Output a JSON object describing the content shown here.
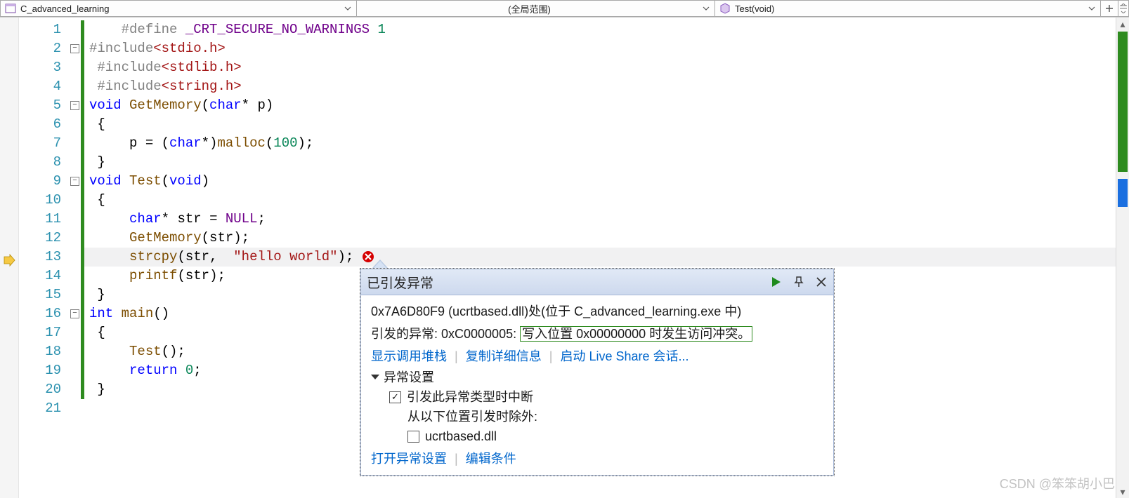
{
  "nav": {
    "left_label": "C_advanced_learning",
    "mid_label": "(全局范围)",
    "right_label": "Test(void)"
  },
  "lines": [
    {
      "n": 1,
      "fold": null,
      "chg": true,
      "tokens": [
        [
          "sp",
          "    "
        ],
        [
          "inc",
          "#define "
        ],
        [
          "mac",
          "_CRT_SECURE_NO_WARNINGS"
        ],
        [
          "sp",
          " "
        ],
        [
          "num",
          "1"
        ]
      ]
    },
    {
      "n": 2,
      "fold": "minus",
      "chg": true,
      "tokens": [
        [
          "inc",
          "#include"
        ],
        [
          "ang",
          "<stdio.h>"
        ]
      ]
    },
    {
      "n": 3,
      "fold": null,
      "chg": true,
      "tokens": [
        [
          "sp",
          " "
        ],
        [
          "inc",
          "#include"
        ],
        [
          "ang",
          "<stdlib.h>"
        ]
      ]
    },
    {
      "n": 4,
      "fold": null,
      "chg": true,
      "tokens": [
        [
          "sp",
          " "
        ],
        [
          "inc",
          "#include"
        ],
        [
          "ang",
          "<string.h>"
        ]
      ]
    },
    {
      "n": 5,
      "fold": "minus",
      "chg": true,
      "tokens": [
        [
          "kw",
          "void"
        ],
        [
          "sp",
          " "
        ],
        [
          "fn",
          "GetMemory"
        ],
        [
          "op",
          "("
        ],
        [
          "kw",
          "char"
        ],
        [
          "op",
          "* "
        ],
        [
          "id",
          "p"
        ],
        [
          "op",
          ")"
        ]
      ]
    },
    {
      "n": 6,
      "fold": null,
      "chg": true,
      "tokens": [
        [
          "sp",
          " "
        ],
        [
          "op",
          "{"
        ]
      ]
    },
    {
      "n": 7,
      "fold": null,
      "chg": true,
      "tokens": [
        [
          "sp",
          "     "
        ],
        [
          "id",
          "p"
        ],
        [
          "sp",
          " "
        ],
        [
          "op",
          "="
        ],
        [
          "sp",
          " "
        ],
        [
          "op",
          "("
        ],
        [
          "kw",
          "char"
        ],
        [
          "op",
          "*)"
        ],
        [
          "fn",
          "malloc"
        ],
        [
          "op",
          "("
        ],
        [
          "num",
          "100"
        ],
        [
          "op",
          ");"
        ]
      ]
    },
    {
      "n": 8,
      "fold": null,
      "chg": true,
      "tokens": [
        [
          "sp",
          " "
        ],
        [
          "op",
          "}"
        ]
      ]
    },
    {
      "n": 9,
      "fold": "minus",
      "chg": true,
      "tokens": [
        [
          "kw",
          "void"
        ],
        [
          "sp",
          " "
        ],
        [
          "fn",
          "Test"
        ],
        [
          "op",
          "("
        ],
        [
          "kw",
          "void"
        ],
        [
          "op",
          ")"
        ]
      ]
    },
    {
      "n": 10,
      "fold": null,
      "chg": true,
      "tokens": [
        [
          "sp",
          " "
        ],
        [
          "op",
          "{"
        ]
      ]
    },
    {
      "n": 11,
      "fold": null,
      "chg": true,
      "tokens": [
        [
          "sp",
          "     "
        ],
        [
          "kw",
          "char"
        ],
        [
          "op",
          "* "
        ],
        [
          "id",
          "str"
        ],
        [
          "sp",
          " "
        ],
        [
          "op",
          "="
        ],
        [
          "sp",
          " "
        ],
        [
          "nul",
          "NULL"
        ],
        [
          "op",
          ";"
        ]
      ]
    },
    {
      "n": 12,
      "fold": null,
      "chg": true,
      "tokens": [
        [
          "sp",
          "     "
        ],
        [
          "fn",
          "GetMemory"
        ],
        [
          "op",
          "("
        ],
        [
          "id",
          "str"
        ],
        [
          "op",
          ");"
        ]
      ]
    },
    {
      "n": 13,
      "fold": null,
      "chg": true,
      "current": true,
      "err": true,
      "tokens": [
        [
          "sp",
          "     "
        ],
        [
          "fn",
          "strcpy"
        ],
        [
          "op",
          "("
        ],
        [
          "id",
          "str"
        ],
        [
          "op",
          ","
        ],
        [
          "sp",
          "  "
        ],
        [
          "str",
          "\"hello world\""
        ],
        [
          "op",
          ");"
        ]
      ]
    },
    {
      "n": 14,
      "fold": null,
      "chg": true,
      "tokens": [
        [
          "sp",
          "     "
        ],
        [
          "fn",
          "printf"
        ],
        [
          "op",
          "("
        ],
        [
          "id",
          "str"
        ],
        [
          "op",
          ");"
        ]
      ]
    },
    {
      "n": 15,
      "fold": null,
      "chg": true,
      "tokens": [
        [
          "sp",
          " "
        ],
        [
          "op",
          "}"
        ]
      ]
    },
    {
      "n": 16,
      "fold": "minus",
      "chg": true,
      "tokens": [
        [
          "kw",
          "int"
        ],
        [
          "sp",
          " "
        ],
        [
          "fn",
          "main"
        ],
        [
          "op",
          "()"
        ]
      ]
    },
    {
      "n": 17,
      "fold": null,
      "chg": true,
      "tokens": [
        [
          "sp",
          " "
        ],
        [
          "op",
          "{"
        ]
      ]
    },
    {
      "n": 18,
      "fold": null,
      "chg": true,
      "tokens": [
        [
          "sp",
          "     "
        ],
        [
          "fn",
          "Test"
        ],
        [
          "op",
          "();"
        ]
      ]
    },
    {
      "n": 19,
      "fold": null,
      "chg": true,
      "tokens": [
        [
          "sp",
          "     "
        ],
        [
          "kw",
          "return"
        ],
        [
          "sp",
          " "
        ],
        [
          "num",
          "0"
        ],
        [
          "op",
          ";"
        ]
      ]
    },
    {
      "n": 20,
      "fold": null,
      "chg": true,
      "tokens": [
        [
          "sp",
          " "
        ],
        [
          "op",
          "}"
        ]
      ]
    },
    {
      "n": 21,
      "fold": null,
      "chg": false,
      "tokens": []
    }
  ],
  "exception": {
    "title": "已引发异常",
    "line1": "0x7A6D80F9 (ucrtbased.dll)处(位于 C_advanced_learning.exe 中)",
    "line2a": "引发的异常: 0xC0000005: ",
    "line2b": "写入位置 0x00000000 时发生访问冲突。",
    "link_stack": "显示调用堆栈",
    "link_copy": "复制详细信息",
    "link_liveshare": "启动 Live Share 会话...",
    "settings_header": "异常设置",
    "chk1_label": "引发此异常类型时中断",
    "sub_label": "从以下位置引发时除外:",
    "chk2_label": "ucrtbased.dll",
    "foot_open": "打开异常设置",
    "foot_edit": "编辑条件"
  },
  "watermark": "CSDN @笨笨胡小巴"
}
